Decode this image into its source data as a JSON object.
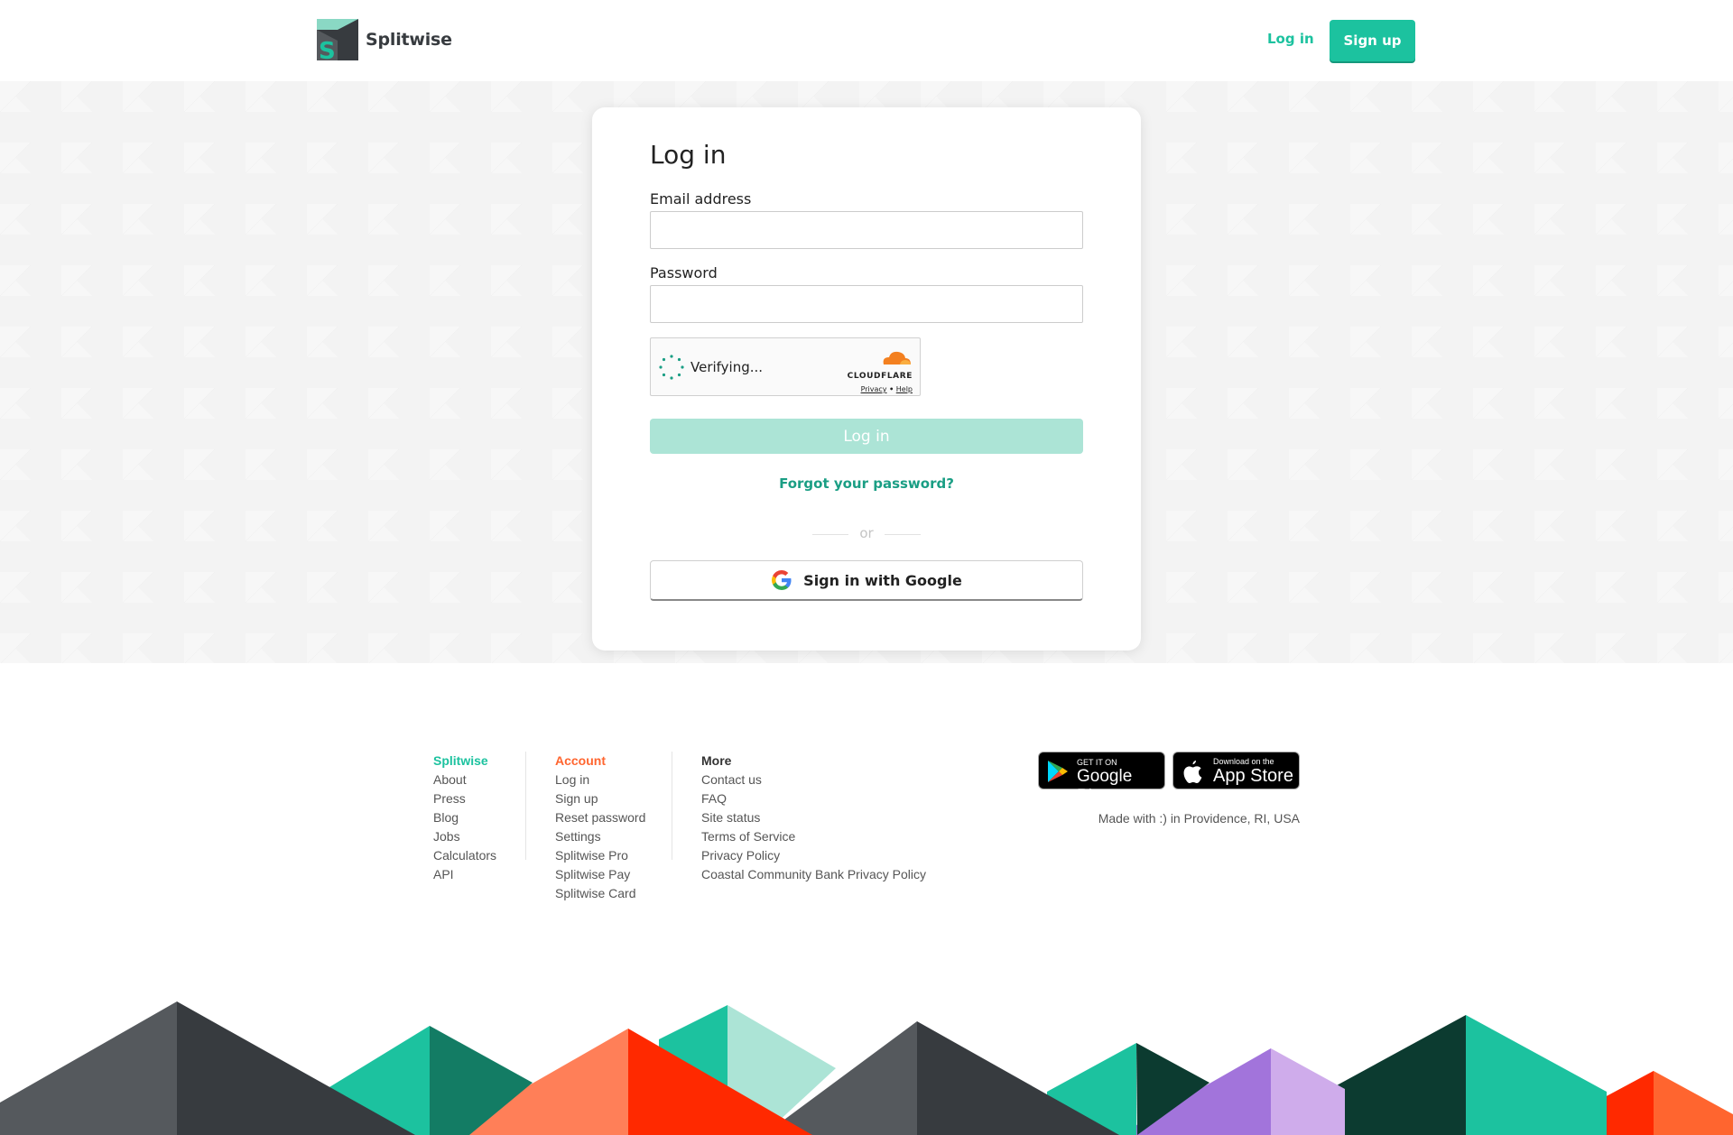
{
  "header": {
    "brand": "Splitwise",
    "login_label": "Log in",
    "signup_label": "Sign up"
  },
  "login_form": {
    "title": "Log in",
    "email_label": "Email address",
    "email_value": "",
    "password_label": "Password",
    "password_value": "",
    "captcha": {
      "status_text": "Verifying...",
      "provider": "CLOUDFLARE",
      "privacy_link": "Privacy",
      "separator": "•",
      "help_link": "Help"
    },
    "submit_label": "Log in",
    "forgot_password": "Forgot your password?",
    "divider_text": "or",
    "google_button": "Sign in with Google"
  },
  "footer": {
    "columns": [
      {
        "heading": "Splitwise",
        "heading_color": "#1cc29f",
        "links": [
          "About",
          "Press",
          "Blog",
          "Jobs",
          "Calculators",
          "API"
        ]
      },
      {
        "heading": "Account",
        "heading_color": "#ff652f",
        "links": [
          "Log in",
          "Sign up",
          "Reset password",
          "Settings",
          "Splitwise Pro",
          "Splitwise Pay",
          "Splitwise Card"
        ]
      },
      {
        "heading": "More",
        "heading_color": "#333333",
        "links": [
          "Contact us",
          "FAQ",
          "Site status",
          "Terms of Service",
          "Privacy Policy",
          "Coastal Community Bank Privacy Policy"
        ]
      }
    ],
    "google_play": {
      "small": "GET IT ON",
      "big": "Google Play"
    },
    "app_store": {
      "small": "Download on the",
      "big": "App Store"
    },
    "made_with": "Made with :) in Providence, RI, USA"
  },
  "colors": {
    "brand_green": "#1cc29f",
    "accent_orange": "#ff652f",
    "dark_gray": "#373b3f",
    "disabled_button": "#ace4d6",
    "link_green": "#1a9e84"
  }
}
